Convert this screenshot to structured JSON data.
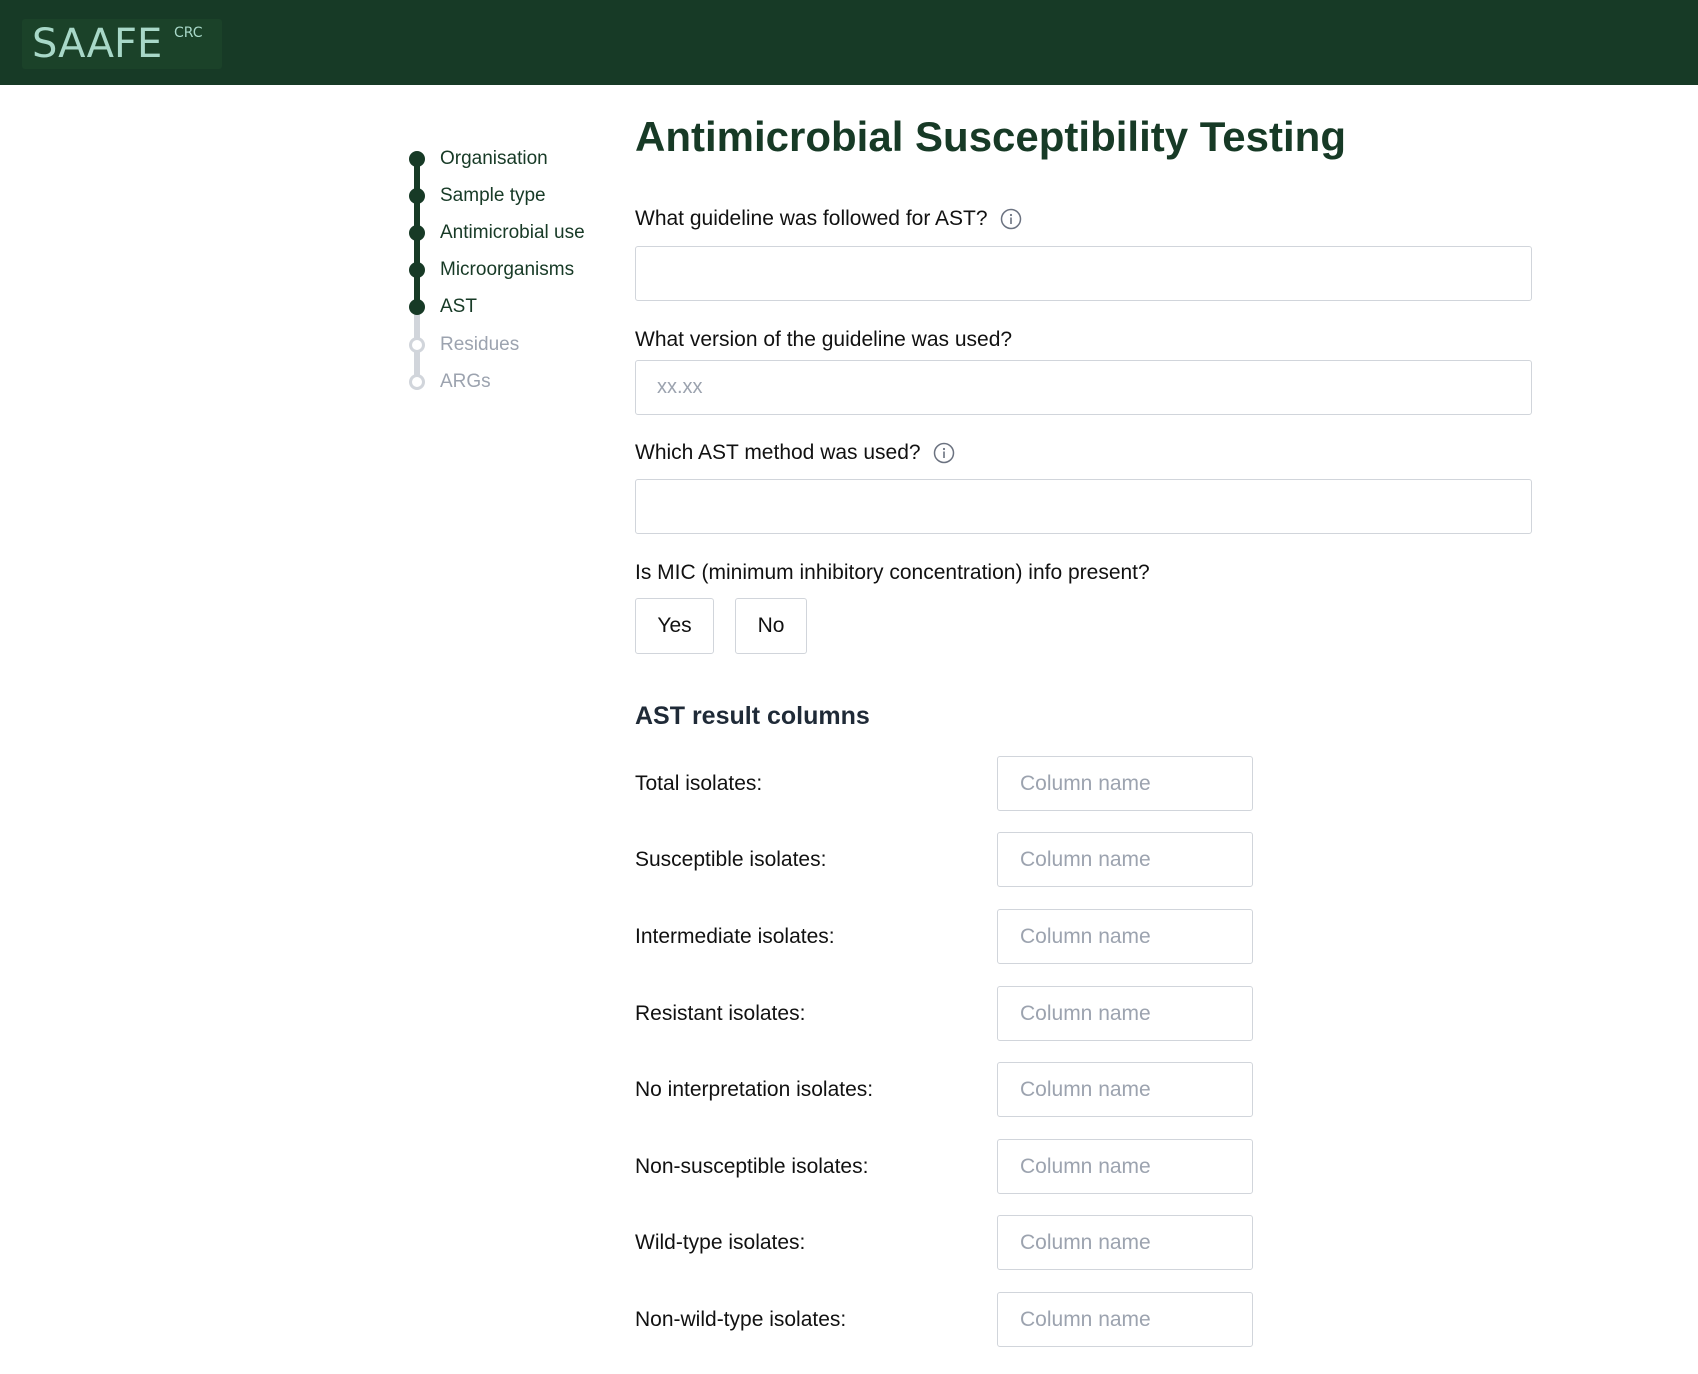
{
  "header": {
    "logo_text": "SAAFE",
    "logo_superscript": "CRC",
    "background_color": "#173a26",
    "logo_color": "#a8d8c8"
  },
  "stepper": {
    "steps": [
      {
        "label": "Organisation",
        "state": "done"
      },
      {
        "label": "Sample type",
        "state": "done"
      },
      {
        "label": "Antimicrobial use",
        "state": "done"
      },
      {
        "label": "Microorganisms",
        "state": "done"
      },
      {
        "label": "AST",
        "state": "done"
      },
      {
        "label": "Residues",
        "state": "todo"
      },
      {
        "label": "ARGs",
        "state": "todo"
      }
    ],
    "done_color": "#173a26",
    "todo_color": "#d1d5db"
  },
  "main": {
    "title": "Antimicrobial Susceptibility Testing",
    "guideline": {
      "label": "What guideline was followed for AST?",
      "info_icon": "info-circle-icon",
      "value": "",
      "placeholder": ""
    },
    "version": {
      "label": "What version of the guideline was used?",
      "value": "",
      "placeholder": "xx.xx"
    },
    "method": {
      "label": "Which AST method was used?",
      "info_icon": "info-circle-icon",
      "value": "",
      "placeholder": ""
    },
    "mic": {
      "label": "Is MIC (minimum inhibitory concentration) info present?",
      "yes_label": "Yes",
      "no_label": "No"
    },
    "result_columns": {
      "title": "AST result columns",
      "placeholder": "Column name",
      "rows": [
        {
          "label": "Total isolates:",
          "value": ""
        },
        {
          "label": "Susceptible isolates:",
          "value": ""
        },
        {
          "label": "Intermediate isolates:",
          "value": ""
        },
        {
          "label": "Resistant isolates:",
          "value": ""
        },
        {
          "label": "No interpretation isolates:",
          "value": ""
        },
        {
          "label": "Non-susceptible isolates:",
          "value": ""
        },
        {
          "label": "Wild-type isolates:",
          "value": ""
        },
        {
          "label": "Non-wild-type isolates:",
          "value": ""
        }
      ]
    }
  }
}
